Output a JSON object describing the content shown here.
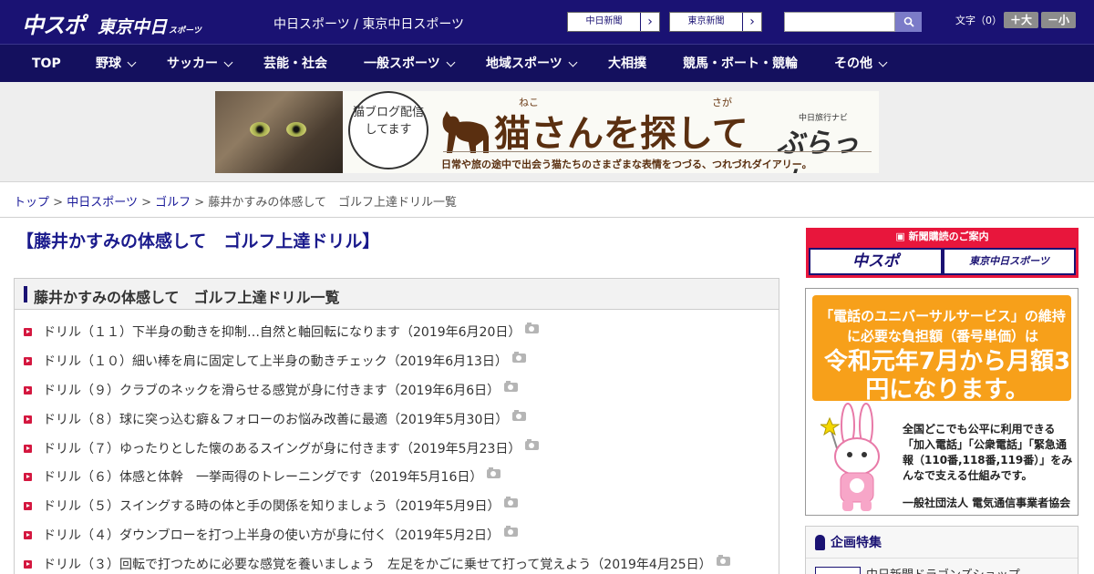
{
  "header": {
    "logo_main": "中スポ",
    "logo_sub": "東京中日",
    "logo_sub_small": "スポーツ",
    "site_title": "中日スポーツ / 東京中日スポーツ",
    "paper_buttons": [
      {
        "label": "中日新聞"
      },
      {
        "label": "東京新聞"
      }
    ],
    "search_placeholder": "",
    "font_label": "文字（0）",
    "font_larger": "＋大",
    "font_smaller": "－小"
  },
  "nav": {
    "items": [
      {
        "label": "TOP",
        "dropdown": false
      },
      {
        "label": "野球",
        "dropdown": true
      },
      {
        "label": "サッカー",
        "dropdown": true
      },
      {
        "label": "芸能・社会",
        "dropdown": false
      },
      {
        "label": "一般スポーツ",
        "dropdown": true
      },
      {
        "label": "地域スポーツ",
        "dropdown": true
      },
      {
        "label": "大相撲",
        "dropdown": false
      },
      {
        "label": "競馬・ボート・競輪",
        "dropdown": false
      },
      {
        "label": "その他",
        "dropdown": true
      }
    ]
  },
  "banner": {
    "bubble_text": "猫ブログ配信してます",
    "ruby_1": "ねこ",
    "ruby_2": "さが",
    "title": "猫さんを探して",
    "navi_small": "中日旅行ナビ",
    "navi": "ぶらっ人",
    "caption": "日常や旅の途中で出会う猫たちのさまざまな表情をつづる、つれづれダイアリー。"
  },
  "breadcrumb": {
    "items": [
      "トップ",
      "中日スポーツ",
      "ゴルフ"
    ],
    "current": "藤井かすみの体感して　ゴルフ上達ドリル一覧",
    "separator": ">"
  },
  "main": {
    "page_title": "【藤井かすみの体感して　ゴルフ上達ドリル】",
    "list_title": "藤井かすみの体感して　ゴルフ上達ドリル一覧",
    "articles": [
      {
        "title": "ドリル（１１）下半身の動きを抑制…自然と軸回転になります（2019年6月20日）",
        "has_photo": true
      },
      {
        "title": "ドリル（１０）細い棒を肩に固定して上半身の動きチェック（2019年6月13日）",
        "has_photo": true
      },
      {
        "title": "ドリル（９）クラブのネックを滑らせる感覚が身に付きます（2019年6月6日）",
        "has_photo": true
      },
      {
        "title": "ドリル（８）球に突っ込む癖＆フォローのお悩み改善に最適（2019年5月30日）",
        "has_photo": true
      },
      {
        "title": "ドリル（７）ゆったりとした懐のあるスイングが身に付きます（2019年5月23日）",
        "has_photo": true
      },
      {
        "title": "ドリル（６）体感と体幹　一挙両得のトレーニングです（2019年5月16日）",
        "has_photo": true
      },
      {
        "title": "ドリル（５）スイングする時の体と手の関係を知りましょう（2019年5月9日）",
        "has_photo": true
      },
      {
        "title": "ドリル（４）ダウンブローを打つ上半身の使い方が身に付く（2019年5月2日）",
        "has_photo": true
      },
      {
        "title": "ドリル（３）回転で打つために必要な感覚を養いましょう　左足をかごに乗せて打って覚えよう（2019年4月25日）",
        "has_photo": true
      }
    ]
  },
  "sidebar": {
    "subscribe_heading": "新聞購読のご案内",
    "subscribe_buttons": [
      "中スポ",
      "東京中日スポーツ"
    ],
    "ad": {
      "line1": "「電話のユニバーサルサービス」の維持に必要な負担額（番号単価）は",
      "big": "令和元年7月から月額3円になります。",
      "small": "全国どこでも公平に利用できる「加入電話」「公衆電話」「緊急通報（110番,118番,119番）」をみんなで支える仕組みです。",
      "org": "一般社団法人 電気通信事業者協会"
    },
    "feature_heading": "企画特集",
    "feature_item": "中日新聞ドラゴンズショップ"
  },
  "colors": {
    "header_bg": "#1a1273",
    "nav_bg": "#14105e",
    "accent_red": "#d4173f",
    "link_blue": "#1a1a99"
  }
}
